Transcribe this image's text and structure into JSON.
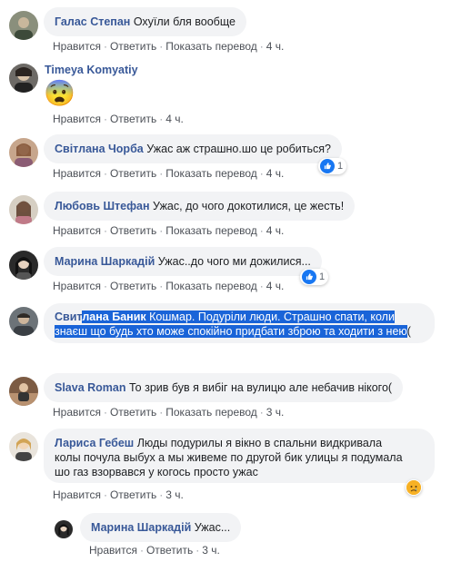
{
  "comments": [
    {
      "author": "Галас Степан",
      "text": "Охуїли бля вообще",
      "actions": {
        "like": "Нравится",
        "reply": "Ответить",
        "translate": "Показать перевод",
        "time": "4 ч."
      }
    },
    {
      "author": "Timeya Komyatiy",
      "emoji": "😨",
      "actions": {
        "like": "Нравится",
        "reply": "Ответить",
        "time": "4 ч."
      }
    },
    {
      "author": "Світлана Чорба",
      "text": "Ужас аж страшно.шо це робиться?",
      "reaction": {
        "icon": "like-icon",
        "count": "1"
      },
      "actions": {
        "like": "Нравится",
        "reply": "Ответить",
        "translate": "Показать перевод",
        "time": "4 ч."
      }
    },
    {
      "author": "Любовь Штефан",
      "text": "Ужас, до чого докотилися, це жесть!",
      "actions": {
        "like": "Нравится",
        "reply": "Ответить",
        "translate": "Показать перевод",
        "time": "4 ч."
      }
    },
    {
      "author": "Марина Шаркадій",
      "text": "Ужас..до чого ми дожилися...",
      "reaction": {
        "icon": "like-icon",
        "count": "1"
      },
      "actions": {
        "like": "Нравится",
        "reply": "Ответить",
        "translate": "Показать перевод",
        "time": "4 ч."
      }
    },
    {
      "author_plain": "Свит",
      "author_selected": "лана Баник",
      "line1": "Кошмар. Подуріли люди. Страшно спати, коли",
      "line2": "знаєш що будь хто може спокійно придбати зброю та ходити з нею",
      "line2_tail": "("
    },
    {
      "author": "Slava Roman",
      "text": "То зрив був я вибіг на вулицю але небачив нікого(",
      "actions": {
        "like": "Нравится",
        "reply": "Ответить",
        "translate": "Показать перевод",
        "time": "3 ч."
      }
    },
    {
      "author": "Лариса Гебеш",
      "line1": "Люды подурилы я вікно в спальни видкривала",
      "line2": "колы почула выбух а мы живеме по другой бик улицы я подумала",
      "line3": "шо газ взорвався у когось просто ужас",
      "reaction": {
        "icon": "sad-icon"
      },
      "actions": {
        "like": "Нравится",
        "reply": "Ответить",
        "time": "3 ч."
      }
    },
    {
      "author": "Марина Шаркадій",
      "text": "Ужас...",
      "actions": {
        "like": "Нравится",
        "reply": "Ответить",
        "time": "3 ч."
      }
    }
  ],
  "colors": {
    "author": "#385898",
    "bubble": "#f2f3f5",
    "selection": "#1a64d8",
    "like": "#1877f2"
  }
}
